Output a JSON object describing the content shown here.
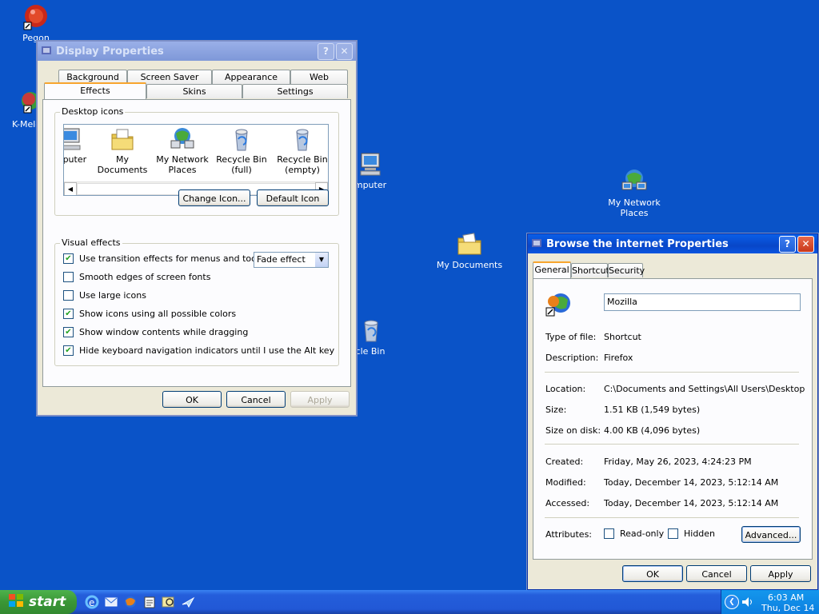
{
  "desktop": {
    "icons": [
      {
        "label": "Pegon"
      },
      {
        "label": "K-Mele"
      },
      {
        "label": "mputer"
      },
      {
        "label": "My Network Places"
      },
      {
        "label": "My Documents"
      },
      {
        "label": "cle Bin"
      }
    ]
  },
  "display": {
    "title": "Display Properties",
    "tabs_row1": [
      "Background",
      "Screen Saver",
      "Appearance",
      "Web"
    ],
    "tabs_row2": [
      "Effects",
      "Skins",
      "Settings"
    ],
    "desktop_icons_label": "Desktop icons",
    "icons": [
      "mputer",
      "My Documents",
      "My Network Places",
      "Recycle Bin (full)",
      "Recycle Bin (empty)"
    ],
    "change_icon": "Change Icon...",
    "default_icon": "Default Icon",
    "visual_effects_label": "Visual effects",
    "options": [
      {
        "label": "Use transition effects for menus and tooltips",
        "checked": true
      },
      {
        "label": "Smooth edges of screen fonts",
        "checked": false
      },
      {
        "label": "Use large icons",
        "checked": false
      },
      {
        "label": "Show icons using all possible colors",
        "checked": true
      },
      {
        "label": "Show window contents while dragging",
        "checked": true
      },
      {
        "label": "Hide keyboard navigation indicators until I use the Alt key",
        "checked": true
      }
    ],
    "effect_select": "Fade effect",
    "ok": "OK",
    "cancel": "Cancel",
    "apply": "Apply"
  },
  "props": {
    "title": "Browse the internet Properties",
    "tabs": [
      "General",
      "Shortcut",
      "Security"
    ],
    "name_value": "Mozilla",
    "type_label": "Type of file:",
    "type_value": "Shortcut",
    "desc_label": "Description:",
    "desc_value": "Firefox",
    "loc_label": "Location:",
    "loc_value": "C:\\Documents and Settings\\All Users\\Desktop",
    "size_label": "Size:",
    "size_value": "1.51 KB (1,549 bytes)",
    "disk_label": "Size on disk:",
    "disk_value": "4.00 KB (4,096 bytes)",
    "created_label": "Created:",
    "created_value": "Friday, May 26, 2023, 4:24:23 PM",
    "modified_label": "Modified:",
    "modified_value": "Today, December 14, 2023, 5:12:14 AM",
    "accessed_label": "Accessed:",
    "accessed_value": "Today, December 14, 2023, 5:12:14 AM",
    "attr_label": "Attributes:",
    "readonly": "Read-only",
    "hidden": "Hidden",
    "advanced": "Advanced...",
    "ok": "OK",
    "cancel": "Cancel",
    "apply": "Apply"
  },
  "taskbar": {
    "start": "start",
    "time": "6:03 AM",
    "date": "Thu, Dec 14"
  }
}
